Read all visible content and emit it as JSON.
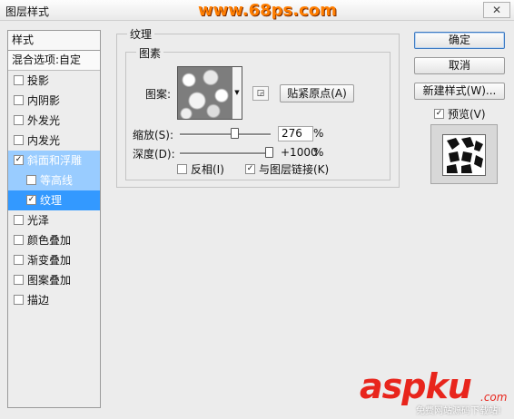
{
  "window": {
    "title": "图层样式",
    "watermark": "www.68ps.com",
    "close_glyph": "✕"
  },
  "sidebar": {
    "header": "样式",
    "blend_options": "混合选项:自定",
    "items": [
      {
        "label": "投影",
        "checked": false
      },
      {
        "label": "内阴影",
        "checked": false
      },
      {
        "label": "外发光",
        "checked": false
      },
      {
        "label": "内发光",
        "checked": false
      },
      {
        "label": "斜面和浮雕",
        "checked": true
      },
      {
        "label": "等高线",
        "checked": false
      },
      {
        "label": "纹理",
        "checked": true
      },
      {
        "label": "光泽",
        "checked": false
      },
      {
        "label": "颜色叠加",
        "checked": false
      },
      {
        "label": "渐变叠加",
        "checked": false
      },
      {
        "label": "图案叠加",
        "checked": false
      },
      {
        "label": "描边",
        "checked": false
      }
    ],
    "check_glyph": "✓"
  },
  "texture": {
    "group_title": "纹理",
    "subgroup_title": "图素",
    "pattern_label": "图案:",
    "snap_button": "贴紧原点(A)",
    "scale_label": "缩放(S):",
    "scale_value": "276",
    "scale_unit": "%",
    "depth_label": "深度(D):",
    "depth_value": "+1000",
    "depth_unit": "%",
    "invert_label": "反相(I)",
    "invert_checked": false,
    "link_label": "与图层链接(K)",
    "link_checked": true
  },
  "actions": {
    "ok": "确定",
    "cancel": "取消",
    "new_style": "新建样式(W)...",
    "preview_label": "预览(V)",
    "preview_checked": true
  },
  "watermarks": {
    "aspku": "aspku",
    "aspku_com": ".com",
    "aspku_sub": "免费网站源码下载站!"
  }
}
